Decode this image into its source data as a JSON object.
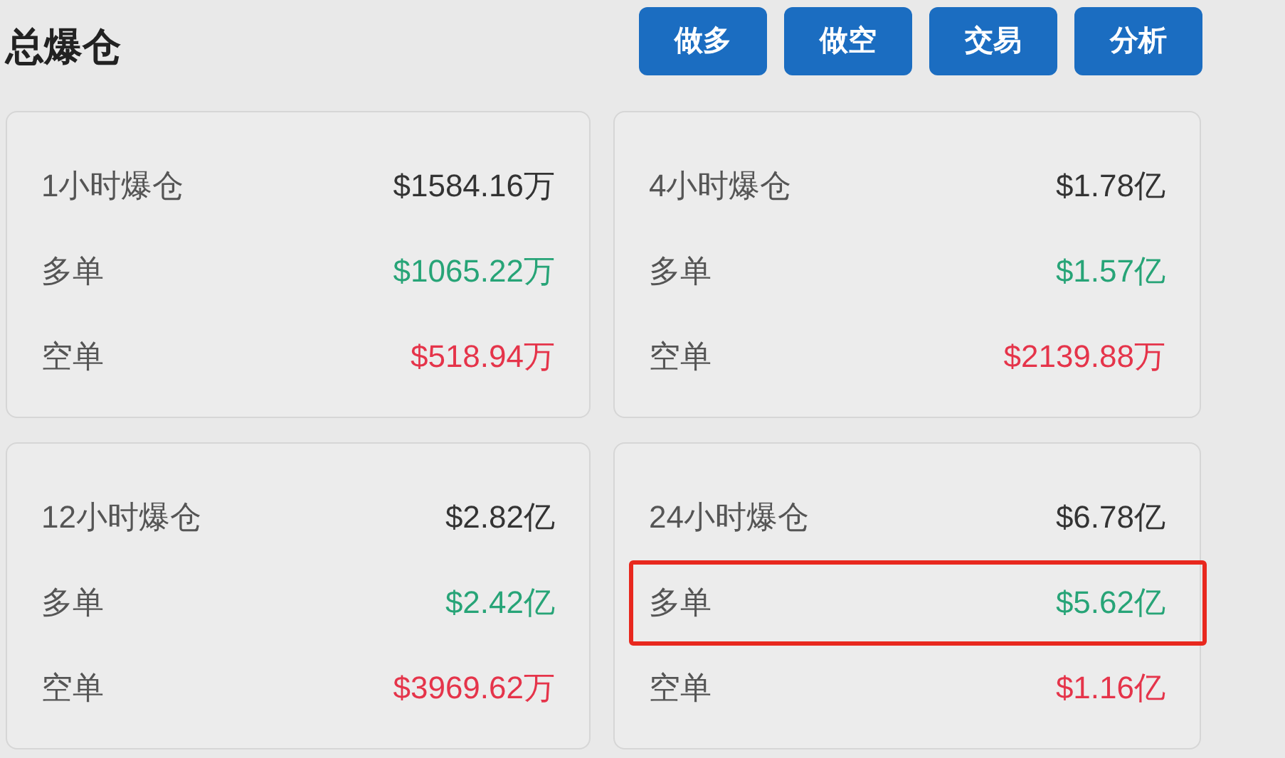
{
  "title": "总爆仓",
  "buttons": [
    {
      "label": "做多"
    },
    {
      "label": "做空"
    },
    {
      "label": "交易"
    },
    {
      "label": "分析"
    }
  ],
  "cards": [
    {
      "label": "1小时爆仓",
      "total": "$1584.16万",
      "rows": [
        {
          "kind": "long",
          "label": "多单",
          "value": "$1065.22万",
          "highlighted": false
        },
        {
          "kind": "short",
          "label": "空单",
          "value": "$518.94万",
          "highlighted": false
        }
      ]
    },
    {
      "label": "4小时爆仓",
      "total": "$1.78亿",
      "rows": [
        {
          "kind": "long",
          "label": "多单",
          "value": "$1.57亿",
          "highlighted": false
        },
        {
          "kind": "short",
          "label": "空单",
          "value": "$2139.88万",
          "highlighted": false
        }
      ]
    },
    {
      "label": "12小时爆仓",
      "total": "$2.82亿",
      "rows": [
        {
          "kind": "long",
          "label": "多单",
          "value": "$2.42亿",
          "highlighted": false
        },
        {
          "kind": "short",
          "label": "空单",
          "value": "$3969.62万",
          "highlighted": false
        }
      ]
    },
    {
      "label": "24小时爆仓",
      "total": "$6.78亿",
      "rows": [
        {
          "kind": "long",
          "label": "多单",
          "value": "$5.62亿",
          "highlighted": true
        },
        {
          "kind": "short",
          "label": "空单",
          "value": "$1.16亿",
          "highlighted": false
        }
      ]
    }
  ]
}
